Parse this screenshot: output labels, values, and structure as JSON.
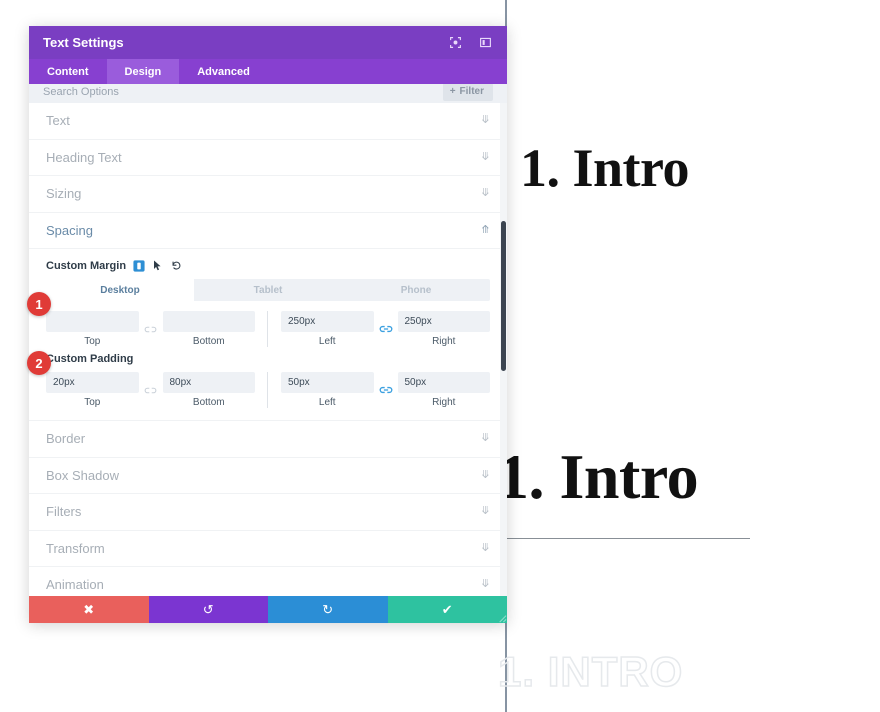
{
  "canvas": {
    "heading_primary": "1. Intro",
    "heading_secondary": "1. Intro",
    "watermark": "1. INTRO"
  },
  "modal": {
    "title": "Text Settings",
    "header_icons": [
      {
        "name": "expand-icon",
        "glyph": "⬚"
      },
      {
        "name": "layout-panel-icon",
        "glyph": "▥"
      }
    ],
    "tabs": [
      {
        "label": "Content",
        "active": false
      },
      {
        "label": "Design",
        "active": true
      },
      {
        "label": "Advanced",
        "active": false
      }
    ],
    "search": {
      "placeholder": "Search Options",
      "filter_label": "Filter",
      "filter_icon": "plus-icon"
    },
    "sections": [
      {
        "label": "Text",
        "open": false
      },
      {
        "label": "Heading Text",
        "open": false
      },
      {
        "label": "Sizing",
        "open": false
      },
      {
        "label": "Spacing",
        "open": true
      },
      {
        "label": "Border",
        "open": false
      },
      {
        "label": "Box Shadow",
        "open": false
      },
      {
        "label": "Filters",
        "open": false
      },
      {
        "label": "Transform",
        "open": false
      },
      {
        "label": "Animation",
        "open": false
      }
    ],
    "spacing": {
      "margin": {
        "label": "Custom Margin",
        "badge": "1",
        "devices": [
          {
            "label": "Desktop",
            "active": true
          },
          {
            "label": "Tablet",
            "active": false
          },
          {
            "label": "Phone",
            "active": false
          }
        ],
        "fields": [
          {
            "side": "Top",
            "value": "",
            "placeholder": ""
          },
          {
            "side": "Bottom",
            "value": "",
            "placeholder": ""
          },
          {
            "side": "Left",
            "value": "250px",
            "placeholder": ""
          },
          {
            "side": "Right",
            "value": "250px",
            "placeholder": ""
          }
        ]
      },
      "padding": {
        "label": "Custom Padding",
        "badge": "2",
        "fields": [
          {
            "side": "Top",
            "value": "20px",
            "placeholder": ""
          },
          {
            "side": "Bottom",
            "value": "80px",
            "placeholder": ""
          },
          {
            "side": "Left",
            "value": "50px",
            "placeholder": ""
          },
          {
            "side": "Right",
            "value": "50px",
            "placeholder": ""
          }
        ]
      }
    },
    "footer": [
      {
        "name": "cancel-button",
        "glyph": "✖",
        "color": "#e9605c"
      },
      {
        "name": "undo-button",
        "glyph": "↺",
        "color": "#7b35d1"
      },
      {
        "name": "redo-button",
        "glyph": "↻",
        "color": "#2b8ed6"
      },
      {
        "name": "save-button",
        "glyph": "✔",
        "color": "#2ec2a0"
      }
    ]
  }
}
